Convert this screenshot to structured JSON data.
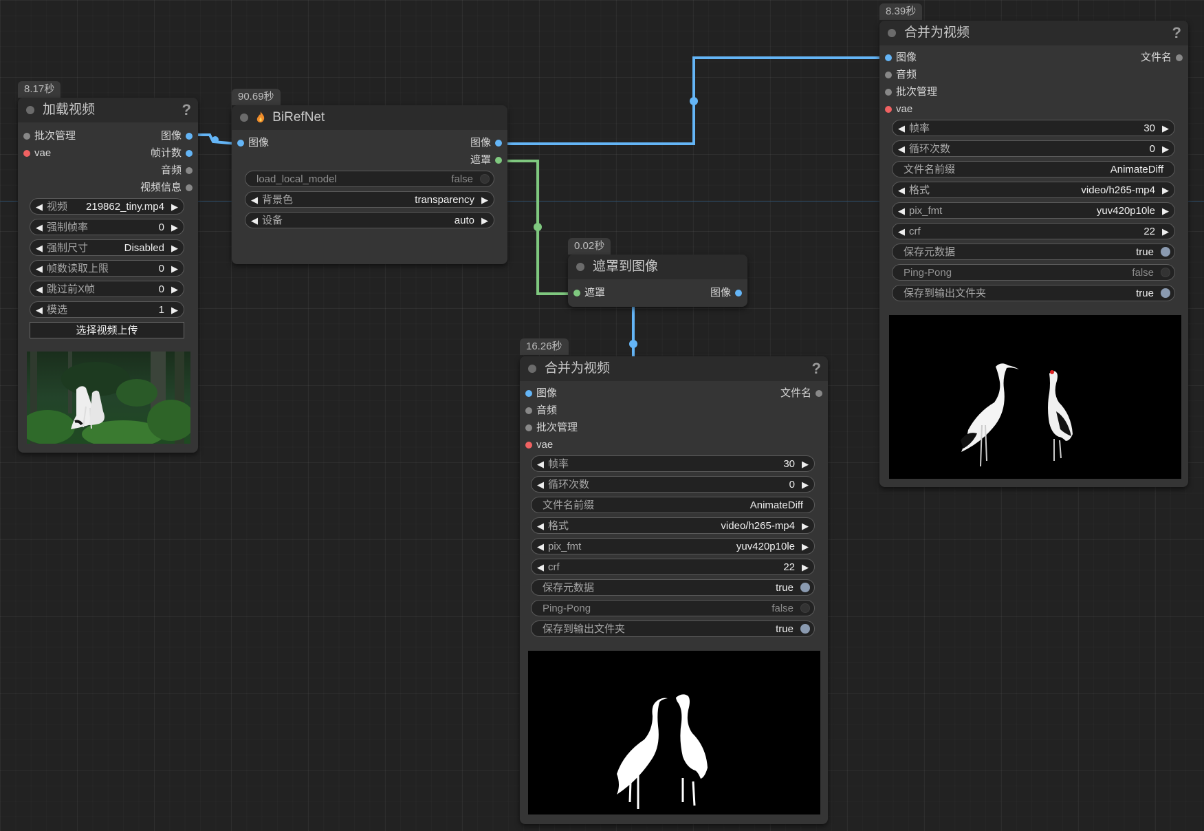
{
  "nodes": {
    "load_video": {
      "time": "8.17秒",
      "title": "加载视频",
      "help": "?",
      "inputs": [
        "批次管理",
        "vae"
      ],
      "outputs": [
        "图像",
        "帧计数",
        "音频",
        "视频信息"
      ],
      "widgets": [
        {
          "label": "视频",
          "value": "219862_tiny.mp4"
        },
        {
          "label": "强制帧率",
          "value": "0"
        },
        {
          "label": "强制尺寸",
          "value": "Disabled"
        },
        {
          "label": "帧数读取上限",
          "value": "0"
        },
        {
          "label": "跳过前X帧",
          "value": "0"
        },
        {
          "label": "模选",
          "value": "1"
        }
      ],
      "upload_button": "选择视频上传"
    },
    "birefnet": {
      "time": "90.69秒",
      "title": "BiRefNet",
      "inputs": [
        "图像"
      ],
      "outputs": [
        "图像",
        "遮罩"
      ],
      "widgets": [
        {
          "label": "load_local_model",
          "value": "false"
        },
        {
          "label": "背景色",
          "value": "transparency"
        },
        {
          "label": "设备",
          "value": "auto"
        }
      ]
    },
    "mask_to_image": {
      "time": "0.02秒",
      "title": "遮罩到图像",
      "inputs": [
        "遮罩"
      ],
      "outputs": [
        "图像"
      ]
    },
    "combine_mask": {
      "time": "16.26秒",
      "title": "合并为视频",
      "help": "?",
      "inputs": [
        "图像",
        "音频",
        "批次管理",
        "vae"
      ],
      "outputs": [
        "文件名"
      ],
      "widgets": [
        {
          "label": "帧率",
          "value": "30"
        },
        {
          "label": "循环次数",
          "value": "0"
        },
        {
          "label": "文件名前缀",
          "value": "AnimateDiff"
        },
        {
          "label": "格式",
          "value": "video/h265-mp4"
        },
        {
          "label": "pix_fmt",
          "value": "yuv420p10le"
        },
        {
          "label": "crf",
          "value": "22"
        },
        {
          "label": "保存元数据",
          "value": "true"
        },
        {
          "label": "Ping-Pong",
          "value": "false"
        },
        {
          "label": "保存到输出文件夹",
          "value": "true"
        }
      ]
    },
    "combine_image": {
      "time": "8.39秒",
      "title": "合并为视频",
      "help": "?",
      "inputs": [
        "图像",
        "音频",
        "批次管理",
        "vae"
      ],
      "outputs": [
        "文件名"
      ],
      "widgets": [
        {
          "label": "帧率",
          "value": "30"
        },
        {
          "label": "循环次数",
          "value": "0"
        },
        {
          "label": "文件名前缀",
          "value": "AnimateDiff"
        },
        {
          "label": "格式",
          "value": "video/h265-mp4"
        },
        {
          "label": "pix_fmt",
          "value": "yuv420p10le"
        },
        {
          "label": "crf",
          "value": "22"
        },
        {
          "label": "保存元数据",
          "value": "true"
        },
        {
          "label": "Ping-Pong",
          "value": "false"
        },
        {
          "label": "保存到输出文件夹",
          "value": "true"
        }
      ]
    }
  },
  "colors": {
    "image_link": "#64b5f6",
    "mask_link": "#7fc87f",
    "vae_slot": "#f06262",
    "background": "#222222",
    "node_body": "#353535"
  },
  "icons": [
    "fire-icon",
    "arrow-left-icon",
    "arrow-right-icon",
    "help-icon"
  ]
}
